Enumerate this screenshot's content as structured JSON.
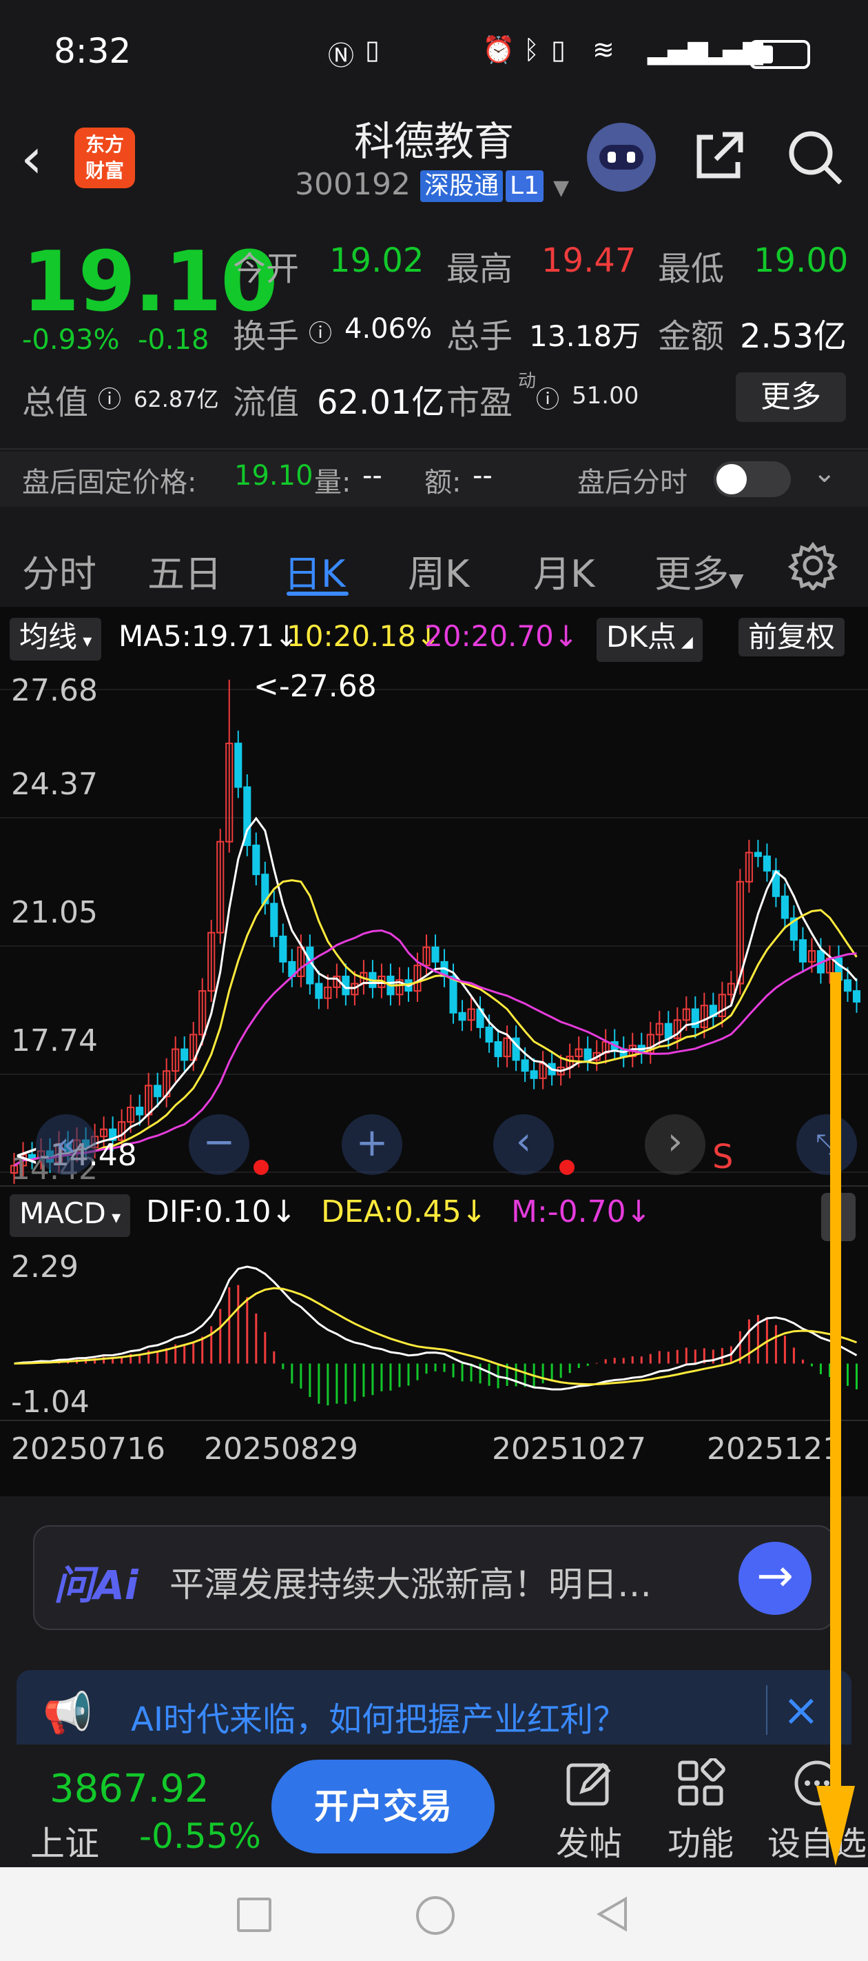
{
  "status_bar": {
    "time": "8:32"
  },
  "header": {
    "logo_line1": "东方",
    "logo_line2": "财富",
    "stock_name": "科德教育",
    "stock_code": "300192",
    "tag_connect": "深股通",
    "tag_level": "L1"
  },
  "quote": {
    "price": "19.10",
    "change_pct": "-0.93%",
    "change_val": "-0.18",
    "open_label": "今开",
    "open": "19.02",
    "high_label": "最高",
    "high": "19.47",
    "low_label": "最低",
    "low": "19.00",
    "turnover_label": "换手",
    "turnover": "4.06%",
    "volume_label": "总手",
    "volume": "13.18万",
    "amount_label": "金额",
    "amount": "2.53亿",
    "mktcap_label": "总值",
    "mktcap": "62.87亿",
    "float_label": "流值",
    "float_cap": "62.01亿",
    "pe_label": "市盈",
    "pe_sup": "动",
    "pe": "51.00",
    "more_label": "更多"
  },
  "after_hours": {
    "price_label": "盘后固定价格:",
    "price": "19.10",
    "vol_label": "量:",
    "vol": "--",
    "amt_label": "额:",
    "amt": "--",
    "timeshare_label": "盘后分时"
  },
  "period_tabs": [
    "分时",
    "五日",
    "日K",
    "周K",
    "月K",
    "更多"
  ],
  "active_tab": 2,
  "chart": {
    "ma_label": "均线",
    "ma5": "MA5:19.71↓",
    "ma10": "10:20.18↓",
    "ma20": "20:20.70↓",
    "dk_label": "DK点",
    "adjust_label": "前复权",
    "y_labels": [
      "27.68",
      "24.37",
      "21.05",
      "17.74",
      "14.42"
    ],
    "max_annotation": "<-27.68",
    "min_annotation": "<-14.48",
    "signal_label": "S",
    "macd_label": "MACD",
    "dif": "DIF:0.10↓",
    "dea": "DEA:0.45↓",
    "m": "M:-0.70↓",
    "macd_y_labels": [
      "2.29",
      "-1.04"
    ],
    "x_labels": [
      "20250716",
      "20250829",
      "20251027",
      "2025121"
    ]
  },
  "colors": {
    "up": "#f03c3c",
    "down": "#12c82a",
    "ma5": "#ffffff",
    "ma10": "#ffea3c",
    "ma20": "#e63cdc",
    "accent": "#3a8aff",
    "annotation": "#ffb400"
  },
  "ai_bar": {
    "logo": "问Ai",
    "text": "平潭发展持续大涨新高！明日…"
  },
  "promo": {
    "text": "AI时代来临，如何把握产业红利？"
  },
  "bottom_bar": {
    "index_value": "3867.92",
    "index_name": "上证",
    "index_change": "-0.55%",
    "trade_label": "开户交易",
    "post_label": "发帖",
    "function_label": "功能",
    "custom_label": "设自选"
  },
  "chart_data": {
    "type": "candlestick",
    "date_range": [
      "20250716",
      "2025121"
    ],
    "y_range": [
      14.42,
      27.68
    ],
    "annotations": {
      "high": 27.68,
      "low": 14.48
    },
    "moving_averages": [
      {
        "name": "MA5",
        "last": 19.71
      },
      {
        "name": "MA10",
        "last": 20.18
      },
      {
        "name": "MA20",
        "last": 20.7
      }
    ],
    "macd": {
      "dif": 0.1,
      "dea": 0.45,
      "m": -0.7,
      "y_range": [
        -1.04,
        2.29
      ]
    },
    "close_series": [
      14.6,
      14.9,
      14.8,
      15.0,
      14.7,
      15.2,
      15.0,
      15.3,
      15.1,
      15.4,
      15.6,
      15.3,
      15.8,
      16.2,
      16.0,
      16.8,
      16.5,
      17.2,
      17.8,
      17.5,
      18.2,
      19.4,
      21.0,
      23.5,
      26.2,
      25.0,
      23.4,
      22.6,
      21.8,
      20.9,
      20.2,
      19.8,
      20.6,
      19.6,
      19.2,
      19.5,
      19.8,
      19.3,
      19.6,
      19.9,
      19.5,
      19.8,
      19.3,
      19.7,
      19.4,
      20.1,
      20.6,
      20.2,
      19.8,
      18.8,
      18.6,
      18.9,
      18.4,
      18.0,
      17.6,
      18.1,
      17.5,
      17.2,
      17.0,
      17.4,
      17.1,
      17.3,
      17.6,
      17.8,
      17.5,
      17.7,
      18.0,
      17.8,
      17.6,
      17.9,
      17.7,
      18.2,
      18.5,
      18.1,
      18.6,
      18.9,
      18.4,
      19.0,
      18.7,
      19.3,
      19.6,
      22.4,
      23.2,
      23.1,
      22.7,
      22.0,
      21.4,
      20.8,
      20.2,
      20.5,
      19.9,
      20.3,
      19.7,
      19.4,
      19.1
    ]
  }
}
